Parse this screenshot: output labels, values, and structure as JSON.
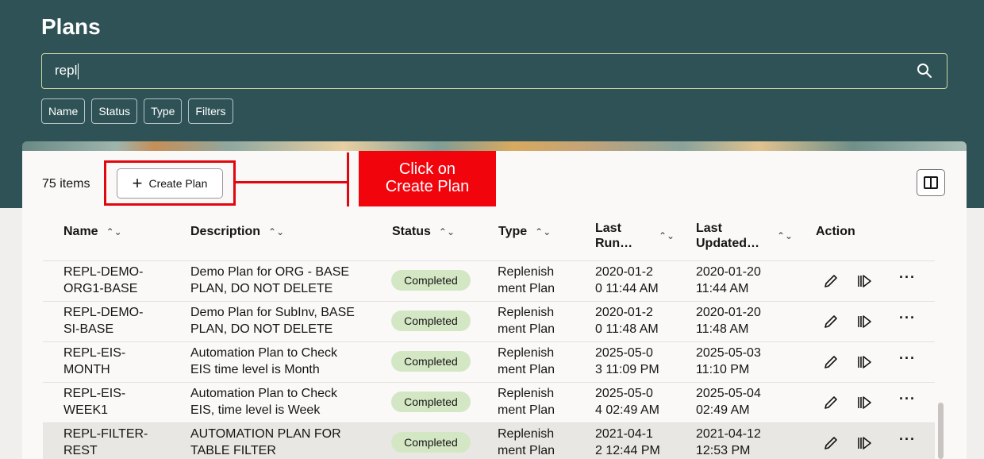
{
  "header": {
    "title": "Plans",
    "search_value": "repl",
    "chips": [
      "Name",
      "Status",
      "Type",
      "Filters"
    ]
  },
  "toolbar": {
    "item_count": "75 items",
    "create_label": "Create Plan",
    "callout_text": "Click on\nCreate Plan"
  },
  "table": {
    "columns": {
      "name": "Name",
      "description": "Description",
      "status": "Status",
      "type": "Type",
      "last_run": "Last\nRun…",
      "last_updated": "Last\nUpdated…",
      "action": "Action"
    },
    "rows": [
      {
        "name": "REPL-DEMO-\nORG1-BASE",
        "description": "Demo Plan for ORG - BASE\nPLAN, DO NOT DELETE",
        "status": "Completed",
        "type": "Replenish\nment Plan",
        "last_run": "2020-01-2\n0 11:44 AM",
        "last_updated": "2020-01-20\n11:44 AM"
      },
      {
        "name": "REPL-DEMO-\nSI-BASE",
        "description": "Demo Plan for SubInv, BASE\nPLAN, DO NOT DELETE",
        "status": "Completed",
        "type": "Replenish\nment Plan",
        "last_run": "2020-01-2\n0 11:48 AM",
        "last_updated": "2020-01-20\n11:48 AM"
      },
      {
        "name": "REPL-EIS-\nMONTH",
        "description": "Automation Plan to Check\nEIS time level is Month",
        "status": "Completed",
        "type": "Replenish\nment Plan",
        "last_run": "2025-05-0\n3 11:09 PM",
        "last_updated": "2025-05-03\n11:10 PM"
      },
      {
        "name": "REPL-EIS-\nWEEK1",
        "description": "Automation Plan to Check\nEIS, time level is Week",
        "status": "Completed",
        "type": "Replenish\nment Plan",
        "last_run": "2025-05-0\n4 02:49 AM",
        "last_updated": "2025-05-04\n02:49 AM"
      },
      {
        "name": "REPL-FILTER-\nREST",
        "description": "AUTOMATION PLAN FOR\nTABLE FILTER",
        "status": "Completed",
        "type": "Replenish\nment Plan",
        "last_run": "2021-04-1\n2 12:44 PM",
        "last_updated": "2021-04-12\n12:53 PM"
      }
    ]
  },
  "colors": {
    "header_bg": "#2f5256",
    "callout_red": "#f2040d",
    "badge_green": "#d4e7c5"
  },
  "icons": [
    "search-icon",
    "plus-icon",
    "columns-icon",
    "edit-icon",
    "run-icon",
    "more-icon",
    "sort-icon"
  ]
}
